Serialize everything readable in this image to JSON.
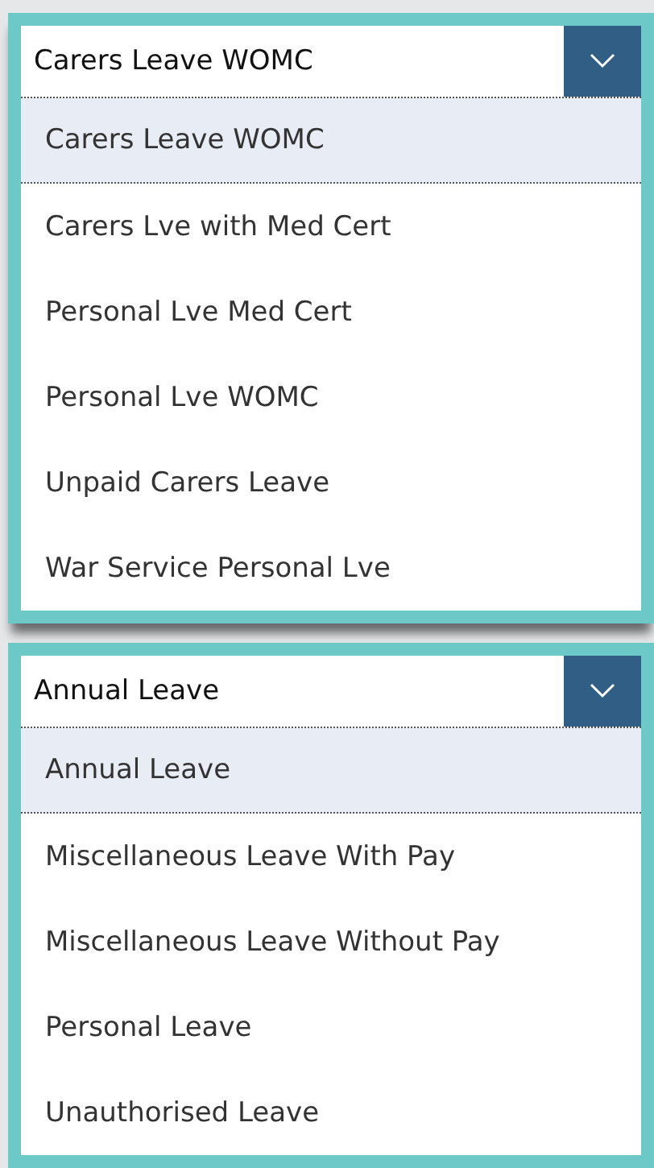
{
  "dropdowns": [
    {
      "value": "Carers Leave WOMC",
      "options": [
        {
          "label": "Carers Leave WOMC",
          "selected": true
        },
        {
          "label": "Carers Lve with Med Cert",
          "selected": false
        },
        {
          "label": "Personal Lve Med Cert",
          "selected": false
        },
        {
          "label": "Personal Lve WOMC",
          "selected": false
        },
        {
          "label": "Unpaid Carers Leave",
          "selected": false
        },
        {
          "label": "War Service Personal Lve",
          "selected": false
        }
      ]
    },
    {
      "value": "Annual Leave",
      "options": [
        {
          "label": "Annual Leave",
          "selected": true
        },
        {
          "label": "Miscellaneous Leave With Pay",
          "selected": false
        },
        {
          "label": "Miscellaneous Leave Without Pay",
          "selected": false
        },
        {
          "label": "Personal Leave",
          "selected": false
        },
        {
          "label": "Unauthorised Leave",
          "selected": false
        }
      ]
    }
  ]
}
